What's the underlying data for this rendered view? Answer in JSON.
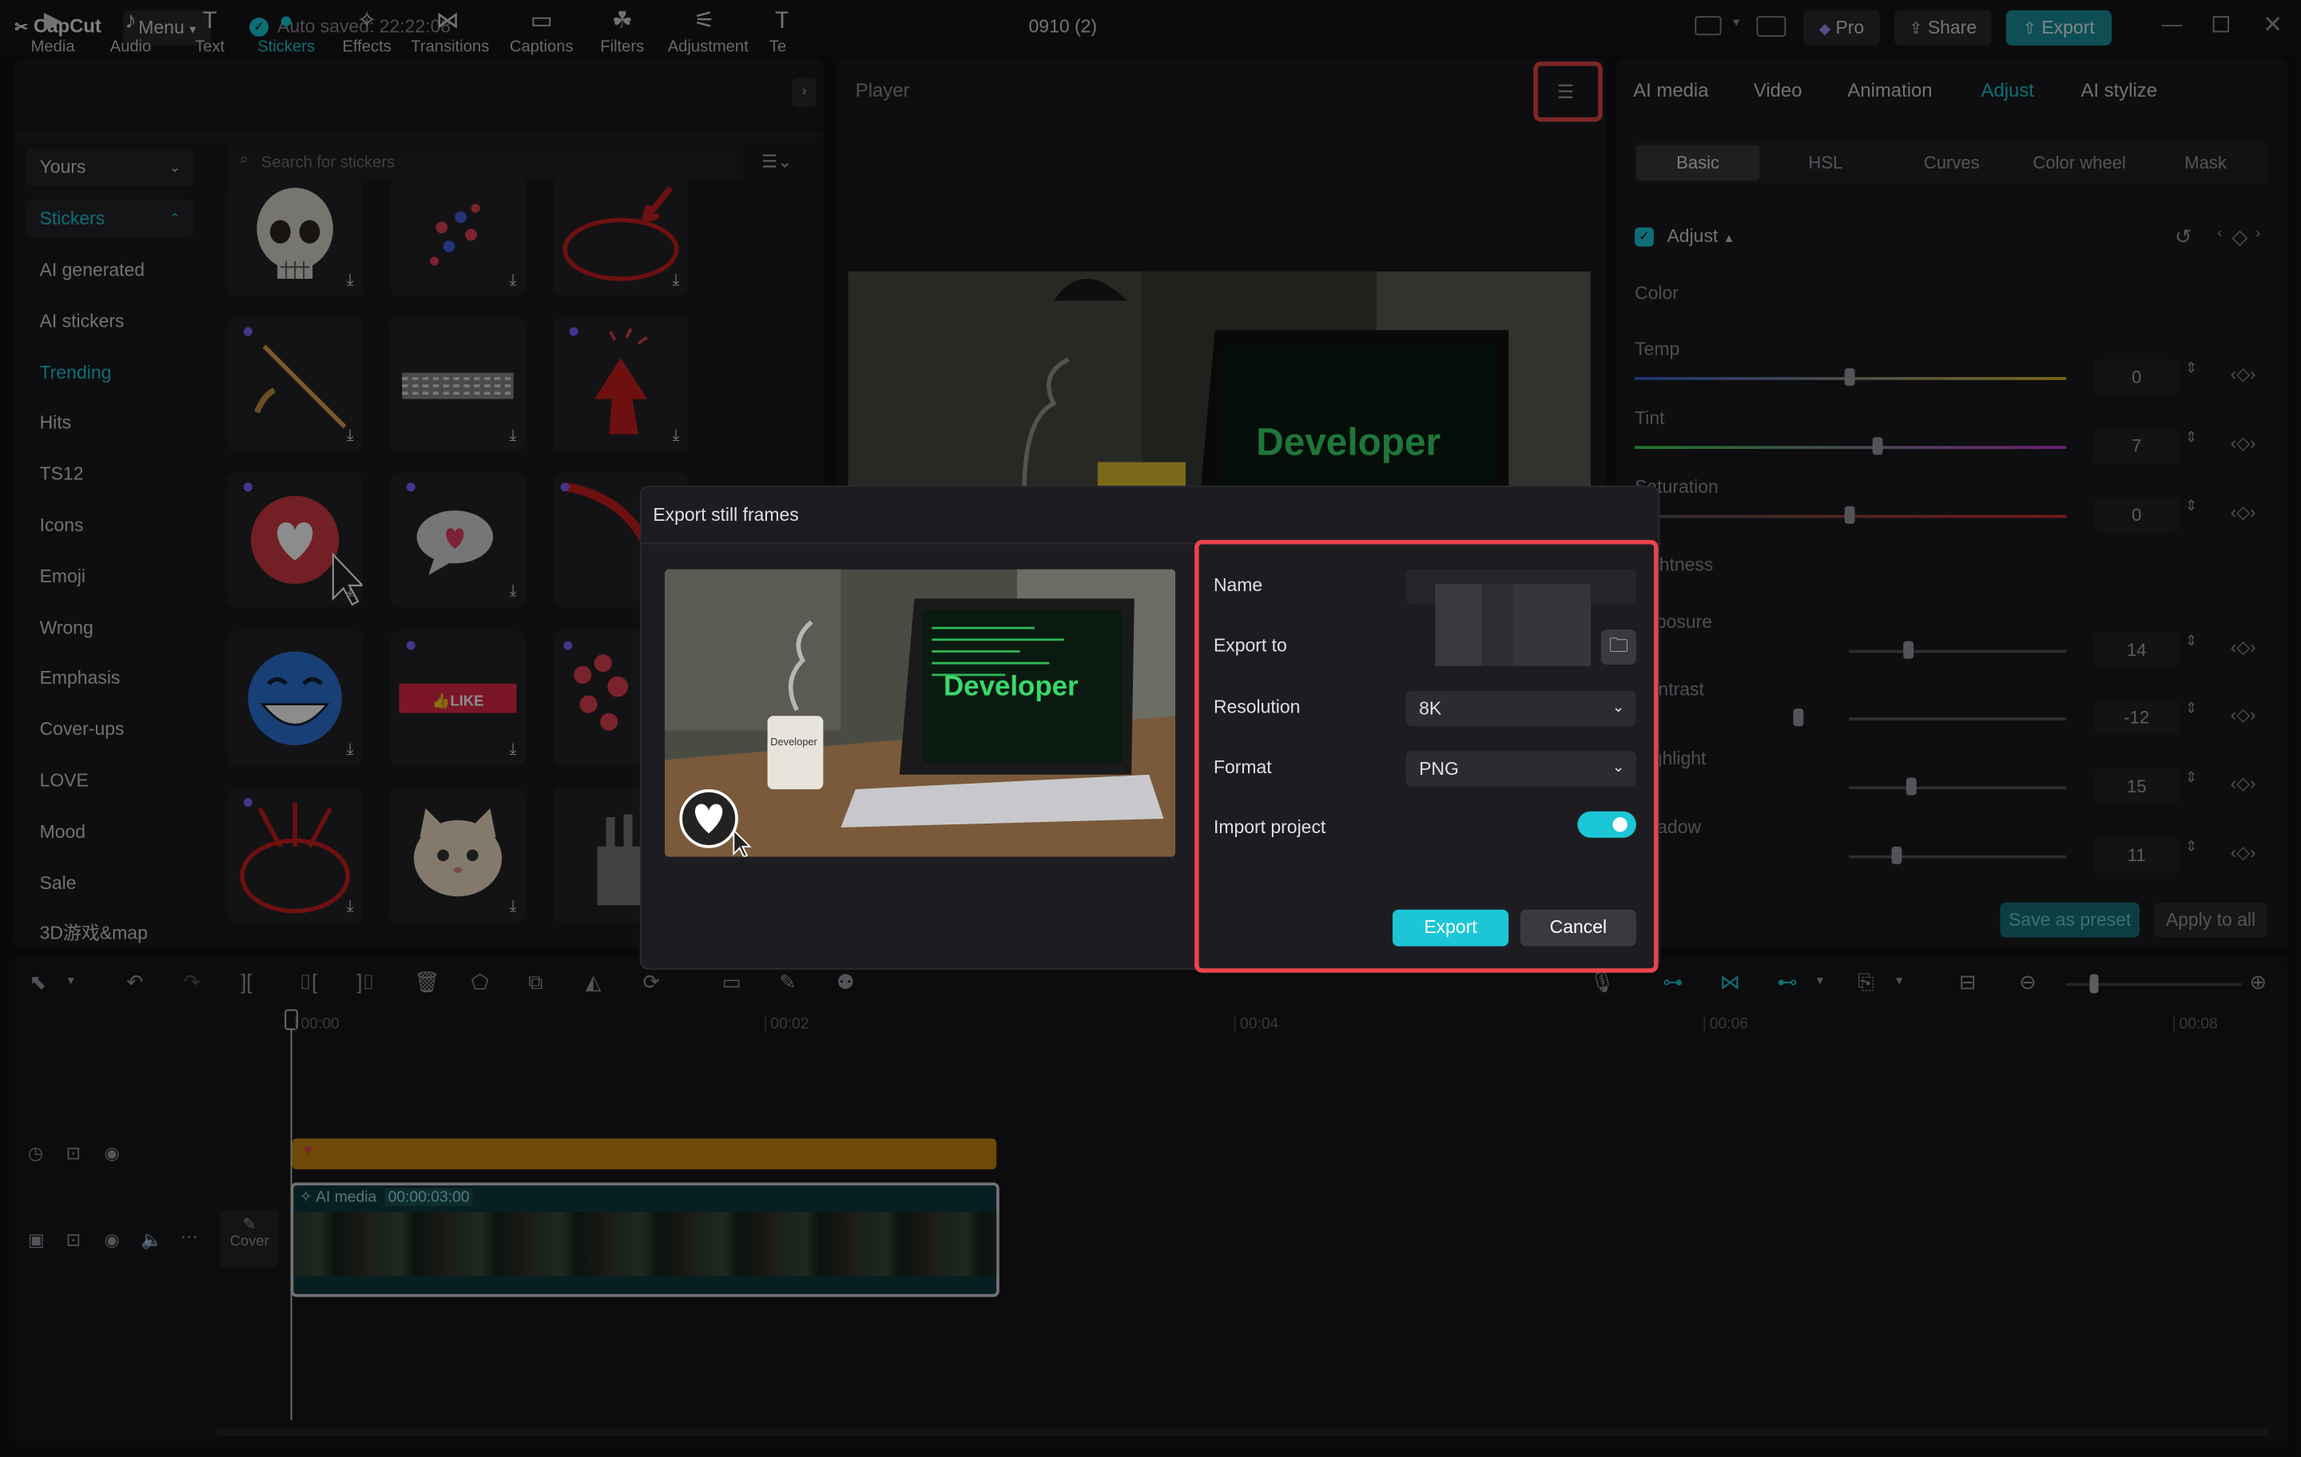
{
  "app": {
    "logo_text": "CapCut",
    "menu_label": "Menu",
    "autosave": "Auto saved: 22:22:08",
    "project_title": "0910 (2)",
    "pro_label": "Pro",
    "share_label": "Share",
    "export_label": "Export"
  },
  "toolbar": {
    "items": [
      {
        "label": "Media",
        "icon": "media-icon"
      },
      {
        "label": "Audio",
        "icon": "audio-icon"
      },
      {
        "label": "Text",
        "icon": "text-icon"
      },
      {
        "label": "Stickers",
        "icon": "stickers-icon"
      },
      {
        "label": "Effects",
        "icon": "effects-icon"
      },
      {
        "label": "Transitions",
        "icon": "transitions-icon"
      },
      {
        "label": "Captions",
        "icon": "captions-icon"
      },
      {
        "label": "Filters",
        "icon": "filters-icon"
      },
      {
        "label": "Adjustment",
        "icon": "adjustment-icon"
      },
      {
        "label": "Te",
        "icon": "template-icon"
      }
    ]
  },
  "sidebar": {
    "yours_label": "Yours",
    "stickers_label": "Stickers",
    "items": [
      "AI generated",
      "AI stickers",
      "Trending",
      "Hits",
      "TS12",
      "Icons",
      "Emoji",
      "Wrong",
      "Emphasis",
      "Cover-ups",
      "LOVE",
      "Mood",
      "Sale",
      "3D游戏&map"
    ]
  },
  "search": {
    "placeholder": "Search for stickers"
  },
  "player": {
    "title": "Player",
    "screen_text": "Developer"
  },
  "right_panel": {
    "tabs": [
      "AI media",
      "Video",
      "Animation",
      "Adjust",
      "AI stylize"
    ],
    "subtabs": [
      "Basic",
      "HSL",
      "Curves",
      "Color wheel",
      "Mask"
    ],
    "adjust_label": "Adjust",
    "color_label": "Color",
    "sliders": [
      {
        "label": "Temp",
        "value": "0"
      },
      {
        "label": "Tint",
        "value": "7"
      },
      {
        "label": "Saturation",
        "value": "0"
      },
      {
        "label": "Lightness",
        "value": ""
      },
      {
        "label": "Exposure",
        "value": "14"
      },
      {
        "label": "Contrast",
        "value": "-12"
      },
      {
        "label": "Highlight",
        "value": "15"
      },
      {
        "label": "Shadow",
        "value": "11"
      }
    ],
    "save_preset": "Save as preset",
    "apply_all": "Apply to all"
  },
  "dialog": {
    "title": "Export still frames",
    "preview_text": "Developer",
    "mug_text": "Developer",
    "fields": {
      "name_label": "Name",
      "name_value": "",
      "export_to_label": "Export to",
      "resolution_label": "Resolution",
      "resolution_value": "8K",
      "format_label": "Format",
      "format_value": "PNG",
      "import_label": "Import project",
      "import_on": true
    },
    "export_button": "Export",
    "cancel_button": "Cancel"
  },
  "timeline": {
    "ticks": [
      "00:00",
      "00:02",
      "00:04",
      "00:06",
      "00:08"
    ],
    "clip_label": "AI media",
    "clip_duration": "00:00:03:00",
    "cover_label": "Cover"
  },
  "colors": {
    "accent": "#1cc6d6",
    "highlight_red": "#e8454a",
    "sticker_bar": "#c8860f"
  }
}
